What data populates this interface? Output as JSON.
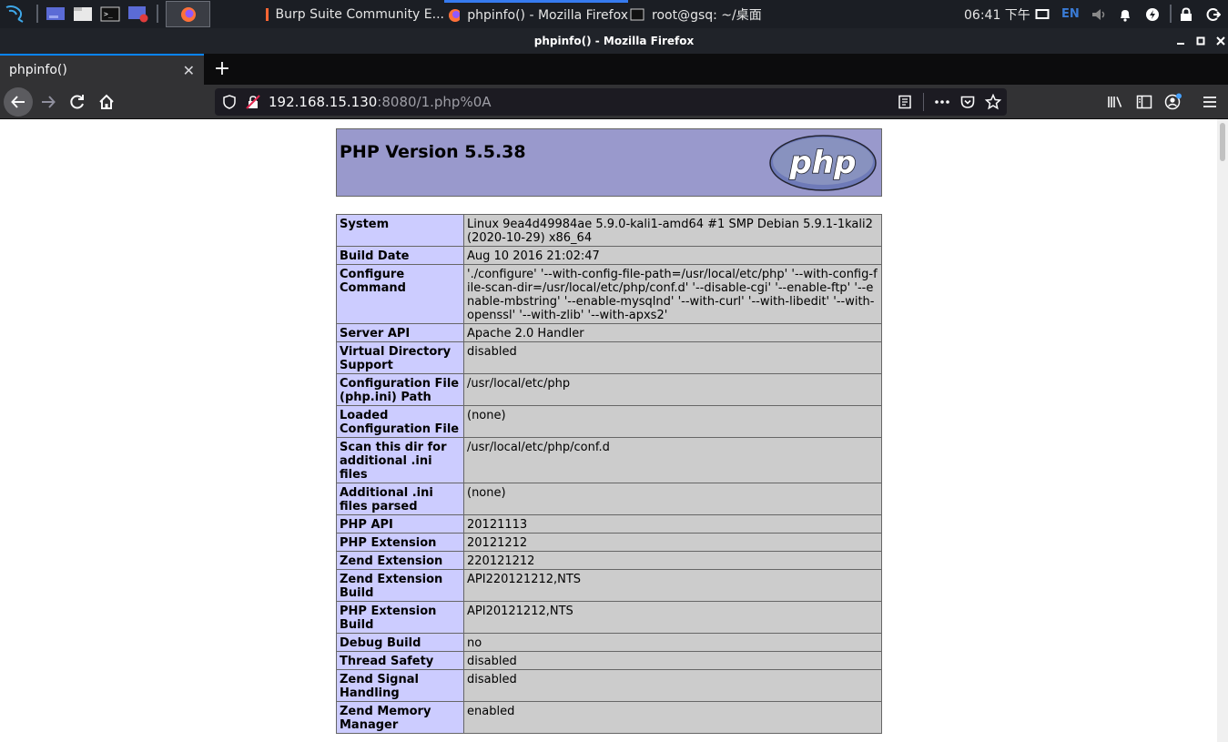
{
  "taskbar": {
    "windows": [
      {
        "title": "Burp Suite Community E..."
      },
      {
        "title": "phpinfo() - Mozilla Firefox"
      },
      {
        "title": "root@gsq: ~/桌面"
      }
    ],
    "clock": "06:41 下午",
    "lang": "EN"
  },
  "window": {
    "title": "phpinfo() - Mozilla Firefox"
  },
  "tab": {
    "title": "phpinfo()"
  },
  "url": {
    "host": "192.168.15.130",
    "rest": ":8080/1.php%0A"
  },
  "page": {
    "header": "PHP Version 5.5.38",
    "logo_text": "php",
    "rows": [
      {
        "key": "System",
        "value": "Linux 9ea4d49984ae 5.9.0-kali1-amd64 #1 SMP Debian 5.9.1-1kali2 (2020-10-29) x86_64"
      },
      {
        "key": "Build Date",
        "value": "Aug 10 2016 21:02:47"
      },
      {
        "key": "Configure Command",
        "value": "'./configure' '--with-config-file-path=/usr/local/etc/php' '--with-config-file-scan-dir=/usr/local/etc/php/conf.d' '--disable-cgi' '--enable-ftp' '--enable-mbstring' '--enable-mysqlnd' '--with-curl' '--with-libedit' '--with-openssl' '--with-zlib' '--with-apxs2'"
      },
      {
        "key": "Server API",
        "value": "Apache 2.0 Handler"
      },
      {
        "key": "Virtual Directory Support",
        "value": "disabled"
      },
      {
        "key": "Configuration File (php.ini) Path",
        "value": "/usr/local/etc/php"
      },
      {
        "key": "Loaded Configuration File",
        "value": "(none)"
      },
      {
        "key": "Scan this dir for additional .ini files",
        "value": "/usr/local/etc/php/conf.d"
      },
      {
        "key": "Additional .ini files parsed",
        "value": "(none)"
      },
      {
        "key": "PHP API",
        "value": "20121113"
      },
      {
        "key": "PHP Extension",
        "value": "20121212"
      },
      {
        "key": "Zend Extension",
        "value": "220121212"
      },
      {
        "key": "Zend Extension Build",
        "value": "API220121212,NTS"
      },
      {
        "key": "PHP Extension Build",
        "value": "API20121212,NTS"
      },
      {
        "key": "Debug Build",
        "value": "no"
      },
      {
        "key": "Thread Safety",
        "value": "disabled"
      },
      {
        "key": "Zend Signal Handling",
        "value": "disabled"
      },
      {
        "key": "Zend Memory Manager",
        "value": "enabled"
      }
    ]
  }
}
